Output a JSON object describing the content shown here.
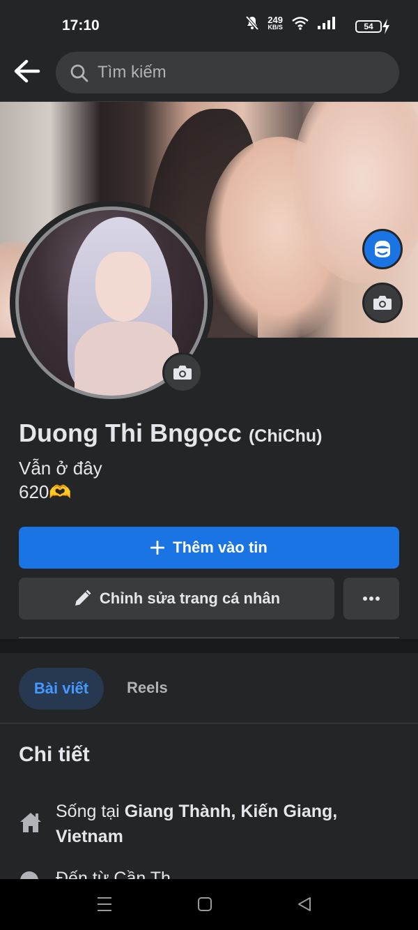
{
  "status_bar": {
    "time": "17:10",
    "net_speed": "249",
    "net_unit": "KB/S",
    "battery": "54",
    "icons": [
      "mute-icon",
      "wifi-icon",
      "signal-icon",
      "battery-icon",
      "charging-icon"
    ]
  },
  "header": {
    "search_placeholder": "Tìm kiếm",
    "icons": [
      "back-arrow-icon",
      "search-icon"
    ]
  },
  "profile": {
    "name": "Duong Thi Bngọcc",
    "nickname": "(ChiChu)",
    "bio_line1": "Vẫn ở đây",
    "bio_line2": "620",
    "bio_emoji": "🫶"
  },
  "actions": {
    "add_story": "Thêm vào tin",
    "edit_profile": "Chỉnh sửa trang cá nhân",
    "more": "…"
  },
  "tabs": {
    "posts": "Bài viết",
    "reels": "Reels",
    "active": "posts"
  },
  "details": {
    "title": "Chi tiết",
    "lives_prefix": "Sống tại ",
    "lives_place": "Giang Thành, Kiến Giang, Vietnam",
    "next_row_partial": "Đến từ Cần Th"
  },
  "colors": {
    "background": "#242526",
    "primary": "#1b74e4",
    "tab_active_bg": "#263951",
    "tab_active_text": "#4599ff",
    "button_secondary": "#3a3b3c"
  }
}
